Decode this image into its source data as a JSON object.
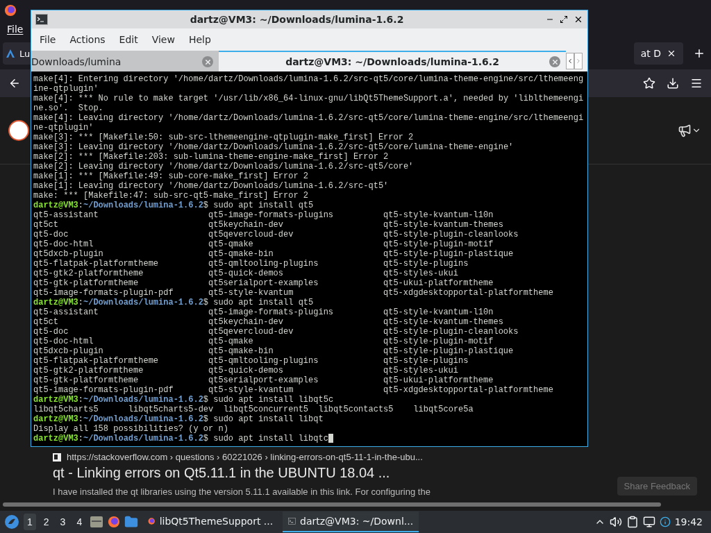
{
  "browser": {
    "menu": [
      "File"
    ],
    "tabs": [
      {
        "label": "Lu",
        "selected": false
      },
      {
        "label": "at D",
        "selected": false
      }
    ],
    "result": {
      "url": "https://stackoverflow.com › questions › 60221026 › linking-errors-on-qt5-11-1-in-the-ubu...",
      "title": "qt - Linking errors on Qt5.11.1 in the UBUNTU 18.04 ...",
      "snippet": "I have installed the qt libraries using the version 5.11.1 available in this link. For configuring the"
    },
    "feedback_button": "Share Feedback"
  },
  "terminal": {
    "title": "dartz@VM3: ~/Downloads/lumina-1.6.2",
    "menu": [
      "File",
      "Actions",
      "Edit",
      "View",
      "Help"
    ],
    "tabs": [
      {
        "label": "Downloads/lumina",
        "selected": false
      },
      {
        "label": "dartz@VM3: ~/Downloads/lumina-1.6.2",
        "selected": true
      }
    ],
    "lines": [
      {
        "kind": "text",
        "text": "make[4]: Entering directory '/home/dartz/Downloads/lumina-1.6.2/src-qt5/core/lumina-theme-engine/src/lthemeeng"
      },
      {
        "kind": "text",
        "text": "ine-qtplugin'"
      },
      {
        "kind": "text",
        "text": "make[4]: *** No rule to make target '/usr/lib/x86_64-linux-gnu/libQt5ThemeSupport.a', needed by 'liblthemeengi"
      },
      {
        "kind": "text",
        "text": "ne.so'.  Stop."
      },
      {
        "kind": "text",
        "text": "make[4]: Leaving directory '/home/dartz/Downloads/lumina-1.6.2/src-qt5/core/lumina-theme-engine/src/lthemeengi"
      },
      {
        "kind": "text",
        "text": "ne-qtplugin'"
      },
      {
        "kind": "text",
        "text": "make[3]: *** [Makefile:50: sub-src-lthemeengine-qtplugin-make_first] Error 2"
      },
      {
        "kind": "text",
        "text": "make[3]: Leaving directory '/home/dartz/Downloads/lumina-1.6.2/src-qt5/core/lumina-theme-engine'"
      },
      {
        "kind": "text",
        "text": "make[2]: *** [Makefile:203: sub-lumina-theme-engine-make_first] Error 2"
      },
      {
        "kind": "text",
        "text": "make[2]: Leaving directory '/home/dartz/Downloads/lumina-1.6.2/src-qt5/core'"
      },
      {
        "kind": "text",
        "text": "make[1]: *** [Makefile:49: sub-core-make_first] Error 2"
      },
      {
        "kind": "text",
        "text": "make[1]: Leaving directory '/home/dartz/Downloads/lumina-1.6.2/src-qt5'"
      },
      {
        "kind": "text",
        "text": "make: *** [Makefile:47: sub-src-qt5-make_first] Error 2"
      },
      {
        "kind": "prompt",
        "user": "dartz@VM3",
        "sep": ":",
        "path": "~/Downloads/lumina-1.6.2",
        "sigil": "$",
        "command": "sudo apt install qt5",
        "cursor": false
      },
      {
        "kind": "columns",
        "cells": [
          "qt5-assistant",
          "qt5-image-formats-plugins",
          "qt5-style-kvantum-l10n"
        ]
      },
      {
        "kind": "columns",
        "cells": [
          "qt5ct",
          "qt5keychain-dev",
          "qt5-style-kvantum-themes"
        ]
      },
      {
        "kind": "columns",
        "cells": [
          "qt5-doc",
          "qt5qevercloud-dev",
          "qt5-style-plugin-cleanlooks"
        ]
      },
      {
        "kind": "columns",
        "cells": [
          "qt5-doc-html",
          "qt5-qmake",
          "qt5-style-plugin-motif"
        ]
      },
      {
        "kind": "columns",
        "cells": [
          "qt5dxcb-plugin",
          "qt5-qmake-bin",
          "qt5-style-plugin-plastique"
        ]
      },
      {
        "kind": "columns",
        "cells": [
          "qt5-flatpak-platformtheme",
          "qt5-qmltooling-plugins",
          "qt5-style-plugins"
        ]
      },
      {
        "kind": "columns",
        "cells": [
          "qt5-gtk2-platformtheme",
          "qt5-quick-demos",
          "qt5-styles-ukui"
        ]
      },
      {
        "kind": "columns",
        "cells": [
          "qt5-gtk-platformtheme",
          "qt5serialport-examples",
          "qt5-ukui-platformtheme"
        ]
      },
      {
        "kind": "columns",
        "cells": [
          "qt5-image-formats-plugin-pdf",
          "qt5-style-kvantum",
          "qt5-xdgdesktopportal-platformtheme"
        ]
      },
      {
        "kind": "prompt",
        "user": "dartz@VM3",
        "sep": ":",
        "path": "~/Downloads/lumina-1.6.2",
        "sigil": "$",
        "command": "sudo apt install qt5",
        "cursor": false
      },
      {
        "kind": "columns",
        "cells": [
          "qt5-assistant",
          "qt5-image-formats-plugins",
          "qt5-style-kvantum-l10n"
        ]
      },
      {
        "kind": "columns",
        "cells": [
          "qt5ct",
          "qt5keychain-dev",
          "qt5-style-kvantum-themes"
        ]
      },
      {
        "kind": "columns",
        "cells": [
          "qt5-doc",
          "qt5qevercloud-dev",
          "qt5-style-plugin-cleanlooks"
        ]
      },
      {
        "kind": "columns",
        "cells": [
          "qt5-doc-html",
          "qt5-qmake",
          "qt5-style-plugin-motif"
        ]
      },
      {
        "kind": "columns",
        "cells": [
          "qt5dxcb-plugin",
          "qt5-qmake-bin",
          "qt5-style-plugin-plastique"
        ]
      },
      {
        "kind": "columns",
        "cells": [
          "qt5-flatpak-platformtheme",
          "qt5-qmltooling-plugins",
          "qt5-style-plugins"
        ]
      },
      {
        "kind": "columns",
        "cells": [
          "qt5-gtk2-platformtheme",
          "qt5-quick-demos",
          "qt5-styles-ukui"
        ]
      },
      {
        "kind": "columns",
        "cells": [
          "qt5-gtk-platformtheme",
          "qt5serialport-examples",
          "qt5-ukui-platformtheme"
        ]
      },
      {
        "kind": "columns",
        "cells": [
          "qt5-image-formats-plugin-pdf",
          "qt5-style-kvantum",
          "qt5-xdgdesktopportal-platformtheme"
        ]
      },
      {
        "kind": "prompt",
        "user": "dartz@VM3",
        "sep": ":",
        "path": "~/Downloads/lumina-1.6.2",
        "sigil": "$",
        "command": "sudo apt install libqt5c",
        "cursor": false
      },
      {
        "kind": "text",
        "text": "libqt5charts5      libqt5charts5-dev  libqt5concurrent5  libqt5contacts5    libqt5core5a"
      },
      {
        "kind": "prompt",
        "user": "dartz@VM3",
        "sep": ":",
        "path": "~/Downloads/lumina-1.6.2",
        "sigil": "$",
        "command": "sudo apt install libqt",
        "cursor": false
      },
      {
        "kind": "text",
        "text": "Display all 158 possibilities? (y or n)"
      },
      {
        "kind": "prompt",
        "user": "dartz@VM3",
        "sep": ":",
        "path": "~/Downloads/lumina-1.6.2",
        "sigil": "$",
        "command": "sudo apt install libqtc",
        "cursor": true
      }
    ]
  },
  "taskbar": {
    "workspaces": [
      {
        "label": "1",
        "selected": true
      },
      {
        "label": "2",
        "selected": false
      },
      {
        "label": "3",
        "selected": false
      },
      {
        "label": "4",
        "selected": false
      }
    ],
    "tasks": [
      {
        "kind": "browser",
        "label": "libQt5ThemeSupport ...",
        "selected": false
      },
      {
        "kind": "terminal",
        "label": "dartz@VM3: ~/Downl...",
        "selected": true
      }
    ],
    "clock": "19:42"
  }
}
